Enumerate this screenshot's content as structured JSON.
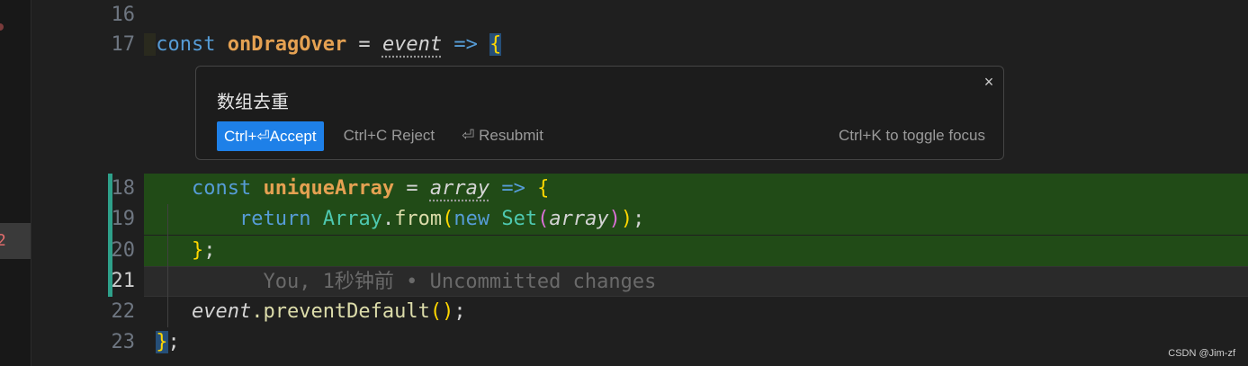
{
  "gutter": {
    "lines": [
      "16",
      "17",
      "18",
      "19",
      "20",
      "21",
      "22",
      "23"
    ],
    "activity_badge": "2"
  },
  "code": {
    "l17": {
      "kw": "const",
      "fn": "onDragOver",
      "eq": " = ",
      "param": "event",
      "arrow": " => ",
      "brace": "{"
    },
    "l18": {
      "kw": "const",
      "fn": "uniqueArray",
      "eq": " = ",
      "param": "array",
      "arrow": " => ",
      "brace": "{"
    },
    "l19": {
      "kw": "return",
      "cls": "Array",
      "dot": ".",
      "fn": "from",
      "p1": "(",
      "kw2": "new",
      "cls2": "Set",
      "p2": "(",
      "param": "array",
      "p3": ")",
      "p4": ")",
      "semi": ";"
    },
    "l20": {
      "brace": "}",
      "semi": ";"
    },
    "l21": {
      "blame": "You, 1秒钟前 • Uncommitted changes"
    },
    "l22": {
      "param": "event",
      "rest": ".preventDefault",
      "p": "()",
      "semi": ";"
    },
    "l23": {
      "brace": "}",
      "semi": ";"
    }
  },
  "inline_chat": {
    "prompt": "数组去重",
    "close": "×",
    "accept": "Ctrl+⏎Accept",
    "reject": "Ctrl+C Reject",
    "resubmit": "⏎ Resubmit",
    "toggle_hint": "Ctrl+K to toggle focus"
  },
  "watermark": "CSDN @Jim-zf",
  "colors": {
    "added_line_bg": "#214b17",
    "accept_button": "#1e80e8",
    "change_bar": "#2ea08a"
  }
}
